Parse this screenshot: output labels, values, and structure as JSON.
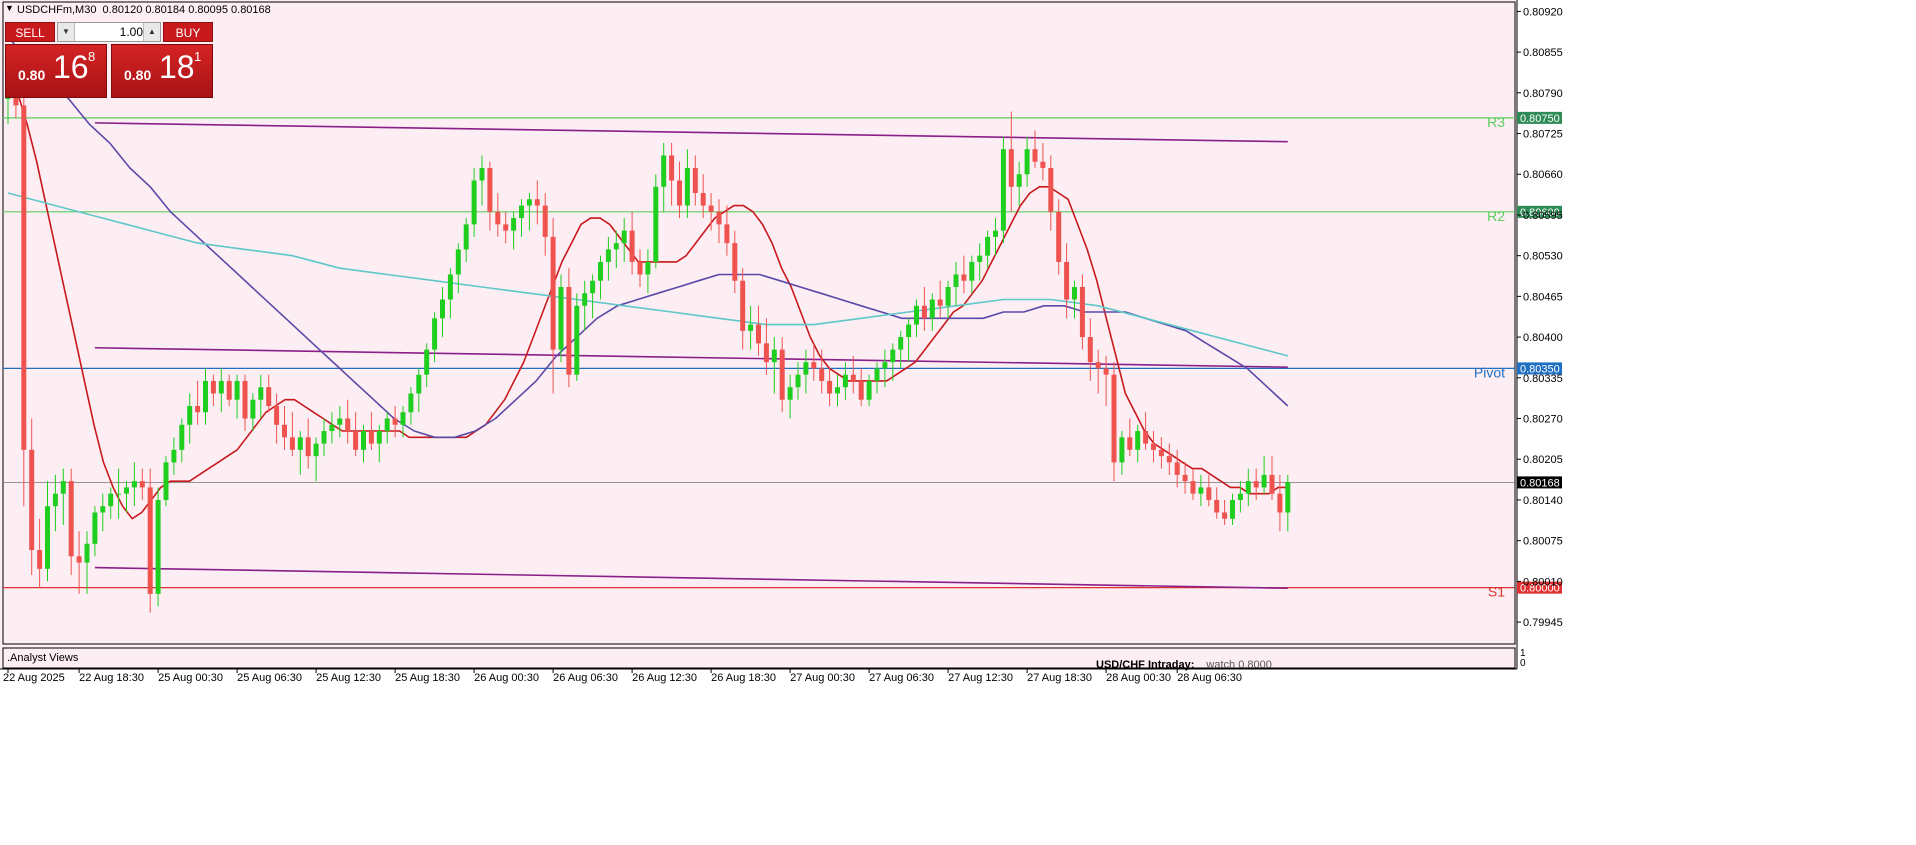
{
  "window": {
    "title": "USDCHFm,M30  0.80120 0.80184 0.80095 0.80168"
  },
  "trade_panel": {
    "sell_label": "SELL",
    "buy_label": "BUY",
    "lot_value": "1.00",
    "bid": {
      "prefix": "0.80",
      "big": "16",
      "sup": "8"
    },
    "ask": {
      "prefix": "0.80",
      "big": "18",
      "sup": "1"
    }
  },
  "subpanel": {
    "label": ".Analyst Views",
    "scale_top": "1",
    "scale_bottom": "0"
  },
  "annotation": {
    "title": "USD/CHF Intraday:",
    "text": "watch 0.8000"
  },
  "colors": {
    "background": "#fdeef4",
    "bull": "#1fce1f",
    "bear": "#ef5350",
    "pivot": "#1f6fc3",
    "r_levels": "#5dce5d",
    "s1": "#e03030",
    "ma_red": "#c8191c",
    "ma_purple": "#5a4aa8",
    "ma_cyan": "#5ec7c7",
    "channel": "#8a1f8a"
  },
  "chart_data": {
    "type": "candlestick",
    "symbol": "USDCHFm",
    "timeframe": "M30",
    "ohlc": {
      "open": 0.8012,
      "high": 0.80184,
      "low": 0.80095,
      "close": 0.80168
    },
    "y_ticks": [
      "0.80920",
      "0.80855",
      "0.80790",
      "0.80725",
      "0.80660",
      "0.80595",
      "0.80530",
      "0.80465",
      "0.80400",
      "0.80335",
      "0.80270",
      "0.80205",
      "0.80140",
      "0.80075",
      "0.80010",
      "0.79945"
    ],
    "ylim": [
      0.7991,
      0.80935
    ],
    "x_ticks": [
      "22 Aug 2025",
      "22 Aug 18:30",
      "25 Aug 00:30",
      "25 Aug 06:30",
      "25 Aug 12:30",
      "25 Aug 18:30",
      "26 Aug 00:30",
      "26 Aug 06:30",
      "26 Aug 12:30",
      "26 Aug 18:30",
      "27 Aug 00:30",
      "27 Aug 06:30",
      "27 Aug 12:30",
      "27 Aug 18:30",
      "28 Aug 00:30",
      "28 Aug 06:30"
    ],
    "current_price": "0.80168",
    "levels": [
      {
        "name": "R3",
        "value": 0.8075,
        "label": "0.80750"
      },
      {
        "name": "R2",
        "value": 0.806,
        "label": "0.80600"
      },
      {
        "name": "Pivot",
        "value": 0.8035,
        "label": "0.80350"
      },
      {
        "name": "S1",
        "value": 0.8,
        "label": "0.80000"
      }
    ],
    "candles": [
      [
        0.8078,
        0.8086,
        0.8074,
        0.8082
      ],
      [
        0.8082,
        0.8085,
        0.8075,
        0.8077
      ],
      [
        0.8077,
        0.8079,
        0.8013,
        0.8022
      ],
      [
        0.8022,
        0.8027,
        0.8002,
        0.8006
      ],
      [
        0.8006,
        0.8011,
        0.8,
        0.8003
      ],
      [
        0.8003,
        0.8017,
        0.8001,
        0.8013
      ],
      [
        0.8013,
        0.8018,
        0.8009,
        0.8015
      ],
      [
        0.8015,
        0.8019,
        0.801,
        0.8017
      ],
      [
        0.8017,
        0.8019,
        0.8002,
        0.8005
      ],
      [
        0.8005,
        0.8009,
        0.7999,
        0.8004
      ],
      [
        0.8004,
        0.8009,
        0.7999,
        0.8007
      ],
      [
        0.8007,
        0.8013,
        0.8005,
        0.8012
      ],
      [
        0.8012,
        0.8015,
        0.8009,
        0.8013
      ],
      [
        0.8013,
        0.8016,
        0.8011,
        0.8015
      ],
      [
        0.8015,
        0.8019,
        0.8011,
        0.8015
      ],
      [
        0.8015,
        0.8017,
        0.8012,
        0.8016
      ],
      [
        0.8016,
        0.802,
        0.8013,
        0.8017
      ],
      [
        0.8017,
        0.8019,
        0.8014,
        0.8016
      ],
      [
        0.8016,
        0.8019,
        0.7996,
        0.7999
      ],
      [
        0.7999,
        0.8016,
        0.7997,
        0.8014
      ],
      [
        0.8014,
        0.8021,
        0.8013,
        0.802
      ],
      [
        0.802,
        0.8024,
        0.8018,
        0.8022
      ],
      [
        0.8022,
        0.8027,
        0.802,
        0.8026
      ],
      [
        0.8026,
        0.8031,
        0.8023,
        0.8029
      ],
      [
        0.8029,
        0.8033,
        0.8026,
        0.8028
      ],
      [
        0.8028,
        0.8035,
        0.8026,
        0.8033
      ],
      [
        0.8033,
        0.8034,
        0.8029,
        0.8031
      ],
      [
        0.8031,
        0.8035,
        0.8028,
        0.8033
      ],
      [
        0.8033,
        0.8034,
        0.8029,
        0.803
      ],
      [
        0.803,
        0.8034,
        0.8027,
        0.8033
      ],
      [
        0.8033,
        0.8034,
        0.8025,
        0.8027
      ],
      [
        0.8027,
        0.8031,
        0.8025,
        0.803
      ],
      [
        0.803,
        0.8034,
        0.8027,
        0.8032
      ],
      [
        0.8032,
        0.8034,
        0.8028,
        0.8029
      ],
      [
        0.8029,
        0.8031,
        0.8023,
        0.8026
      ],
      [
        0.8026,
        0.8029,
        0.8022,
        0.8024
      ],
      [
        0.8024,
        0.8028,
        0.8021,
        0.8022
      ],
      [
        0.8022,
        0.8025,
        0.8018,
        0.8024
      ],
      [
        0.8024,
        0.8027,
        0.8019,
        0.8021
      ],
      [
        0.8021,
        0.8024,
        0.8017,
        0.8023
      ],
      [
        0.8023,
        0.8027,
        0.8021,
        0.8025
      ],
      [
        0.8025,
        0.8028,
        0.8023,
        0.8026
      ],
      [
        0.8026,
        0.8029,
        0.8024,
        0.8027
      ],
      [
        0.8027,
        0.803,
        0.8023,
        0.8025
      ],
      [
        0.8025,
        0.8028,
        0.8021,
        0.8022
      ],
      [
        0.8022,
        0.8026,
        0.802,
        0.8025
      ],
      [
        0.8025,
        0.8028,
        0.8022,
        0.8023
      ],
      [
        0.8023,
        0.8026,
        0.802,
        0.8025
      ],
      [
        0.8025,
        0.8028,
        0.8023,
        0.8027
      ],
      [
        0.8027,
        0.8029,
        0.8024,
        0.8026
      ],
      [
        0.8026,
        0.8029,
        0.8024,
        0.8028
      ],
      [
        0.8028,
        0.8032,
        0.8026,
        0.8031
      ],
      [
        0.8031,
        0.8035,
        0.8028,
        0.8034
      ],
      [
        0.8034,
        0.8039,
        0.8032,
        0.8038
      ],
      [
        0.8038,
        0.8044,
        0.8036,
        0.8043
      ],
      [
        0.8043,
        0.8048,
        0.804,
        0.8046
      ],
      [
        0.8046,
        0.8051,
        0.8043,
        0.805
      ],
      [
        0.805,
        0.8055,
        0.8047,
        0.8054
      ],
      [
        0.8054,
        0.8059,
        0.8052,
        0.8058
      ],
      [
        0.8058,
        0.8067,
        0.8056,
        0.8065
      ],
      [
        0.8065,
        0.8069,
        0.8061,
        0.8067
      ],
      [
        0.8067,
        0.8068,
        0.8057,
        0.806
      ],
      [
        0.806,
        0.8063,
        0.8056,
        0.8058
      ],
      [
        0.8058,
        0.806,
        0.8055,
        0.8057
      ],
      [
        0.8057,
        0.806,
        0.8054,
        0.8059
      ],
      [
        0.8059,
        0.8062,
        0.8056,
        0.8061
      ],
      [
        0.8061,
        0.8063,
        0.8057,
        0.8062
      ],
      [
        0.8062,
        0.8065,
        0.8058,
        0.8061
      ],
      [
        0.8061,
        0.8063,
        0.8053,
        0.8056
      ],
      [
        0.8056,
        0.8059,
        0.8031,
        0.8038
      ],
      [
        0.8038,
        0.805,
        0.8036,
        0.8048
      ],
      [
        0.8048,
        0.8051,
        0.8032,
        0.8034
      ],
      [
        0.8034,
        0.8047,
        0.8033,
        0.8045
      ],
      [
        0.8045,
        0.8049,
        0.8041,
        0.8047
      ],
      [
        0.8047,
        0.805,
        0.8043,
        0.8049
      ],
      [
        0.8049,
        0.8053,
        0.8046,
        0.8052
      ],
      [
        0.8052,
        0.8056,
        0.8049,
        0.8054
      ],
      [
        0.8054,
        0.8057,
        0.8051,
        0.8055
      ],
      [
        0.8055,
        0.8059,
        0.8052,
        0.8057
      ],
      [
        0.8057,
        0.806,
        0.805,
        0.8052
      ],
      [
        0.8052,
        0.8054,
        0.8048,
        0.805
      ],
      [
        0.805,
        0.8054,
        0.8047,
        0.8052
      ],
      [
        0.8052,
        0.8066,
        0.8051,
        0.8064
      ],
      [
        0.8064,
        0.8071,
        0.806,
        0.8069
      ],
      [
        0.8069,
        0.8071,
        0.8061,
        0.8065
      ],
      [
        0.8065,
        0.8068,
        0.8059,
        0.8061
      ],
      [
        0.8061,
        0.807,
        0.8059,
        0.8067
      ],
      [
        0.8067,
        0.8069,
        0.8061,
        0.8063
      ],
      [
        0.8063,
        0.8066,
        0.8059,
        0.8061
      ],
      [
        0.8061,
        0.8063,
        0.8057,
        0.806
      ],
      [
        0.806,
        0.8062,
        0.8055,
        0.8058
      ],
      [
        0.8058,
        0.8061,
        0.8053,
        0.8055
      ],
      [
        0.8055,
        0.8057,
        0.8047,
        0.8049
      ],
      [
        0.8049,
        0.8051,
        0.8038,
        0.8041
      ],
      [
        0.8041,
        0.8045,
        0.8038,
        0.8042
      ],
      [
        0.8042,
        0.8045,
        0.8037,
        0.8039
      ],
      [
        0.8039,
        0.8043,
        0.8034,
        0.8036
      ],
      [
        0.8036,
        0.804,
        0.8031,
        0.8038
      ],
      [
        0.8038,
        0.804,
        0.8028,
        0.803
      ],
      [
        0.803,
        0.8034,
        0.8027,
        0.8032
      ],
      [
        0.8032,
        0.8036,
        0.803,
        0.8034
      ],
      [
        0.8034,
        0.8038,
        0.8031,
        0.8036
      ],
      [
        0.8036,
        0.8039,
        0.8033,
        0.8035
      ],
      [
        0.8035,
        0.8038,
        0.8031,
        0.8033
      ],
      [
        0.8033,
        0.8035,
        0.8029,
        0.8031
      ],
      [
        0.8031,
        0.8034,
        0.8029,
        0.8032
      ],
      [
        0.8032,
        0.8036,
        0.803,
        0.8034
      ],
      [
        0.8034,
        0.8037,
        0.8031,
        0.8033
      ],
      [
        0.8033,
        0.8035,
        0.8029,
        0.803
      ],
      [
        0.803,
        0.8034,
        0.8029,
        0.8033
      ],
      [
        0.8033,
        0.8036,
        0.8031,
        0.8035
      ],
      [
        0.8035,
        0.8038,
        0.8032,
        0.8036
      ],
      [
        0.8036,
        0.8039,
        0.8033,
        0.8038
      ],
      [
        0.8038,
        0.8041,
        0.8035,
        0.804
      ],
      [
        0.804,
        0.8043,
        0.8036,
        0.8042
      ],
      [
        0.8042,
        0.8046,
        0.804,
        0.8045
      ],
      [
        0.8045,
        0.8048,
        0.8041,
        0.8043
      ],
      [
        0.8043,
        0.8047,
        0.8041,
        0.8046
      ],
      [
        0.8046,
        0.8049,
        0.8043,
        0.8045
      ],
      [
        0.8045,
        0.8049,
        0.8043,
        0.8048
      ],
      [
        0.8048,
        0.8052,
        0.8045,
        0.805
      ],
      [
        0.805,
        0.8053,
        0.8047,
        0.8049
      ],
      [
        0.8049,
        0.8053,
        0.8047,
        0.8052
      ],
      [
        0.8052,
        0.8055,
        0.8049,
        0.8053
      ],
      [
        0.8053,
        0.8057,
        0.8051,
        0.8056
      ],
      [
        0.8056,
        0.8059,
        0.8053,
        0.8057
      ],
      [
        0.8057,
        0.8072,
        0.8055,
        0.807
      ],
      [
        0.807,
        0.8076,
        0.806,
        0.8064
      ],
      [
        0.8064,
        0.8068,
        0.8061,
        0.8066
      ],
      [
        0.8066,
        0.8072,
        0.8064,
        0.807
      ],
      [
        0.807,
        0.8073,
        0.8067,
        0.8068
      ],
      [
        0.8068,
        0.8071,
        0.8065,
        0.8067
      ],
      [
        0.8067,
        0.8069,
        0.8057,
        0.806
      ],
      [
        0.806,
        0.8062,
        0.805,
        0.8052
      ],
      [
        0.8052,
        0.8055,
        0.8043,
        0.8046
      ],
      [
        0.8046,
        0.8049,
        0.8043,
        0.8048
      ],
      [
        0.8048,
        0.805,
        0.8038,
        0.804
      ],
      [
        0.804,
        0.8043,
        0.8033,
        0.8036
      ],
      [
        0.8036,
        0.8038,
        0.8031,
        0.8035
      ],
      [
        0.8035,
        0.8037,
        0.8029,
        0.8034
      ],
      [
        0.8034,
        0.8036,
        0.8017,
        0.802
      ],
      [
        0.802,
        0.8025,
        0.8018,
        0.8024
      ],
      [
        0.8024,
        0.8027,
        0.8021,
        0.8022
      ],
      [
        0.8022,
        0.8026,
        0.802,
        0.8025
      ],
      [
        0.8025,
        0.8028,
        0.8022,
        0.8023
      ],
      [
        0.8023,
        0.8025,
        0.802,
        0.8022
      ],
      [
        0.8022,
        0.8024,
        0.8019,
        0.8021
      ],
      [
        0.8021,
        0.8023,
        0.8018,
        0.802
      ],
      [
        0.802,
        0.8022,
        0.8016,
        0.8018
      ],
      [
        0.8018,
        0.802,
        0.8015,
        0.8017
      ],
      [
        0.8017,
        0.8019,
        0.8014,
        0.8015
      ],
      [
        0.8015,
        0.8018,
        0.8013,
        0.8016
      ],
      [
        0.8016,
        0.8018,
        0.8013,
        0.8014
      ],
      [
        0.8014,
        0.8016,
        0.8011,
        0.8012
      ],
      [
        0.8012,
        0.8014,
        0.801,
        0.8011
      ],
      [
        0.8011,
        0.8015,
        0.801,
        0.8014
      ],
      [
        0.8014,
        0.8017,
        0.8012,
        0.8015
      ],
      [
        0.8015,
        0.8019,
        0.8013,
        0.8017
      ],
      [
        0.8017,
        0.8019,
        0.8014,
        0.8016
      ],
      [
        0.8016,
        0.8021,
        0.8015,
        0.8018
      ],
      [
        0.8018,
        0.8021,
        0.8014,
        0.8015
      ],
      [
        0.8015,
        0.8018,
        0.8009,
        0.8012
      ],
      [
        0.8012,
        0.8018,
        0.8009,
        0.80168
      ]
    ],
    "x_tick_candle_index": [
      0,
      9,
      19,
      29,
      39,
      49,
      59,
      69,
      79,
      89,
      99,
      109,
      119,
      129,
      139,
      148
    ],
    "moving_averages": [
      {
        "color": "red",
        "values": [
          0.8082,
          0.8079,
          0.8074,
          0.8068,
          0.8061,
          0.8054,
          0.8047,
          0.804,
          0.8033,
          0.8026,
          0.802,
          0.8016,
          0.8013,
          0.8011,
          0.8012,
          0.8014,
          0.8016,
          0.8017,
          0.8017,
          0.8017,
          0.8018,
          0.8019,
          0.802,
          0.8021,
          0.8022,
          0.8024,
          0.8026,
          0.8028,
          0.8029,
          0.803,
          0.803,
          0.8029,
          0.8028,
          0.8027,
          0.8026,
          0.8025,
          0.8025,
          0.8025,
          0.8025,
          0.8025,
          0.8025,
          0.8025,
          0.8024,
          0.8024,
          0.8024,
          0.8024,
          0.8024,
          0.8024,
          0.8024,
          0.8025,
          0.8026,
          0.8028,
          0.803,
          0.8033,
          0.8036,
          0.804,
          0.8044,
          0.8048,
          0.8052,
          0.8055,
          0.8058,
          0.8059,
          0.8059,
          0.8058,
          0.8056,
          0.8054,
          0.8052,
          0.8052,
          0.8052,
          0.8052,
          0.8052,
          0.8053,
          0.8055,
          0.8057,
          0.8059,
          0.806,
          0.8061,
          0.8061,
          0.806,
          0.8058,
          0.8055,
          0.8051,
          0.8048,
          0.8044,
          0.804,
          0.8037,
          0.8035,
          0.8034,
          0.8033,
          0.8033,
          0.8033,
          0.8033,
          0.8033,
          0.8034,
          0.8035,
          0.8036,
          0.8038,
          0.804,
          0.8042,
          0.8044,
          0.8045,
          0.8047,
          0.8049,
          0.8052,
          0.8055,
          0.8058,
          0.8061,
          0.8063,
          0.8064,
          0.8064,
          0.8063,
          0.8062,
          0.8058,
          0.8054,
          0.8049,
          0.8043,
          0.8037,
          0.8031,
          0.8028,
          0.8025,
          0.8023,
          0.8022,
          0.8021,
          0.802,
          0.8019,
          0.8019,
          0.8018,
          0.8017,
          0.8016,
          0.8016,
          0.8015,
          0.8015,
          0.8015,
          0.8016,
          0.8016
        ]
      },
      {
        "color": "purple",
        "values": [
          0.8088,
          0.8084,
          0.8081,
          0.8078,
          0.8074,
          0.8071,
          0.8067,
          0.8064,
          0.806,
          0.8057,
          0.8054,
          0.8051,
          0.8048,
          0.8045,
          0.8042,
          0.8039,
          0.8036,
          0.8033,
          0.803,
          0.8027,
          0.8025,
          0.8024,
          0.8024,
          0.8025,
          0.8027,
          0.803,
          0.8033,
          0.8037,
          0.804,
          0.8043,
          0.8045,
          0.8046,
          0.8047,
          0.8048,
          0.8049,
          0.805,
          0.805,
          0.805,
          0.8049,
          0.8048,
          0.8047,
          0.8046,
          0.8045,
          0.8044,
          0.8043,
          0.8043,
          0.8043,
          0.8043,
          0.8043,
          0.8044,
          0.8044,
          0.8045,
          0.8045,
          0.8044,
          0.8044,
          0.8044,
          0.8043,
          0.8042,
          0.8041,
          0.8039,
          0.8037,
          0.8035,
          0.8032,
          0.8029
        ]
      },
      {
        "color": "cyan",
        "values": [
          0.8063,
          0.8061,
          0.8059,
          0.8057,
          0.8055,
          0.8054,
          0.8053,
          0.8051,
          0.805,
          0.8049,
          0.8048,
          0.8047,
          0.8046,
          0.8045,
          0.8044,
          0.8043,
          0.8042,
          0.8042,
          0.8043,
          0.8044,
          0.8045,
          0.8046,
          0.8046,
          0.8045,
          0.8043,
          0.8041,
          0.8039,
          0.8037
        ]
      }
    ]
  }
}
